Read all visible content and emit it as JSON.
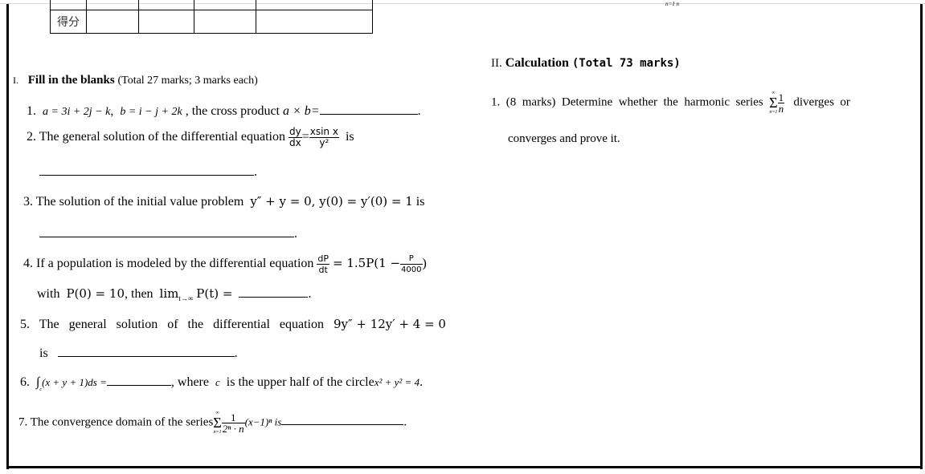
{
  "score_table": {
    "row_label": "得分"
  },
  "top_residual": "n=1  n",
  "section1": {
    "numeral": "I.",
    "title": "Fill in the blanks",
    "note": "(Total 27 marks; 3 marks each)"
  },
  "q1": {
    "num": "1.",
    "a_eq": "a = 3i + 2j − k",
    "b_eq": "b = i − j + 2k",
    "text": ", the cross product",
    "expr": "a × b=",
    "end": "."
  },
  "q2": {
    "text": "2. The general solution of the differential equation",
    "num_l": "dy",
    "den_l": "dx",
    "num_r": "xsin x",
    "den_r": "y²",
    "tail": "is",
    "end": "."
  },
  "q3": {
    "text": "3. The solution of the initial value problem",
    "eq": "y″ + y = 0, y(0) = y′(0) = 1",
    "tail": "is",
    "end": "."
  },
  "q4": {
    "text": "4. If a population is modeled by the differential equation",
    "num_l": "dP",
    "den_l": "dt",
    "eq_mid": "= 1.5P(1 −",
    "num_r": "P",
    "den_r": "4000",
    "close": ")",
    "line2_pre": "with",
    "p0": "P(0) = 10",
    "line2_mid": ", then",
    "lim": "lim",
    "lim_sub": "t→∞",
    "pt": "P(t) =",
    "end": "."
  },
  "q5": {
    "text": "5.   The   general   solution   of   the   differential   equation",
    "eq": "9y″ + 12y′ + 4 = 0",
    "line2": "is",
    "end": "."
  },
  "q6": {
    "num": "6.",
    "integral": "∫",
    "int_sub": "c",
    "expr": "(x + y + 1)ds =",
    "tail_a": ", where",
    "c": "c",
    "tail_b": "is the upper half of the circle",
    "circle": "x² + y² = 4",
    "end": "."
  },
  "q7": {
    "text": "7. The convergence domain of the series",
    "sum_top": "∞",
    "sum_bot": "n=1",
    "num": "1",
    "den": "2ⁿ · n",
    "expr": "(x−1)ⁿ is",
    "end": "."
  },
  "section2": {
    "numeral": "II.",
    "title": "Calculation",
    "note": "(Total 73 marks)"
  },
  "c1": {
    "lead": "1.  (8  marks)  Determine  whether  the  harmonic  series",
    "sum_top": "∞",
    "sum_bot": "n=1",
    "num": "1",
    "den": "n",
    "tail": "diverges  or",
    "line2": "converges and prove it."
  }
}
